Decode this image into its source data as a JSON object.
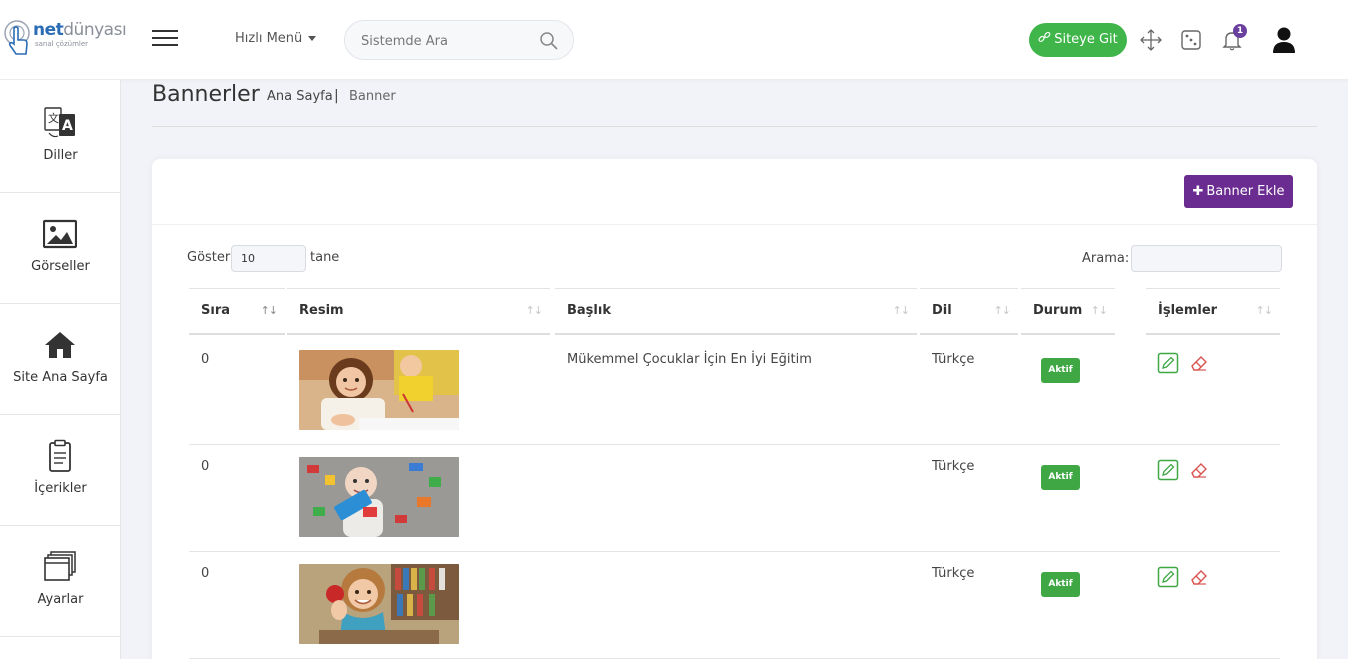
{
  "header": {
    "logo": {
      "brand_a": "net",
      "brand_b": "dünyası",
      "tagline": "sanal çözümler"
    },
    "quick_menu_label": "Hızlı Menü",
    "search_placeholder": "Sistemde Ara",
    "site_button_label": "Siteye Git",
    "notification_count": "1",
    "icons": [
      "menu-icon",
      "search-icon",
      "link-icon",
      "expand-arrows-icon",
      "dice-icon",
      "bell-icon",
      "user-avatar-icon"
    ]
  },
  "sidebar": {
    "items": [
      {
        "label": "Diller",
        "icon": "language-icon"
      },
      {
        "label": "Görseller",
        "icon": "image-icon"
      },
      {
        "label": "Site Ana Sayfa",
        "icon": "home-icon"
      },
      {
        "label": "İçerikler",
        "icon": "clipboard-icon"
      },
      {
        "label": "Ayarlar",
        "icon": "windows-stack-icon"
      }
    ]
  },
  "page": {
    "title": "Bannerler",
    "breadcrumb": {
      "home": "Ana Sayfa",
      "separator": "|",
      "current": "Banner"
    }
  },
  "card": {
    "add_button_label": "Banner Ekle",
    "length": {
      "label": "Göster",
      "value": "10",
      "suffix": "tane"
    },
    "filter": {
      "label": "Arama:",
      "value": ""
    },
    "columns": [
      "Sıra",
      "Resim",
      "Başlık",
      "Dil",
      "Durum",
      "İşlemler"
    ],
    "rows": [
      {
        "order": "0",
        "image": "girl-drawing-photo",
        "title": "Mükemmel Çocuklar İçin En İyi Eğitim",
        "lang": "Türkçe",
        "status": "Aktif"
      },
      {
        "order": "0",
        "image": "child-with-blocks-photo",
        "title": "",
        "lang": "Türkçe",
        "status": "Aktif"
      },
      {
        "order": "0",
        "image": "girl-with-apple-photo",
        "title": "",
        "lang": "Türkçe",
        "status": "Aktif"
      }
    ]
  },
  "colors": {
    "accent_purple": "#6a2c91",
    "success_green": "#3fb54a",
    "status_green": "#3fa845",
    "delete_red": "#d9534f"
  }
}
